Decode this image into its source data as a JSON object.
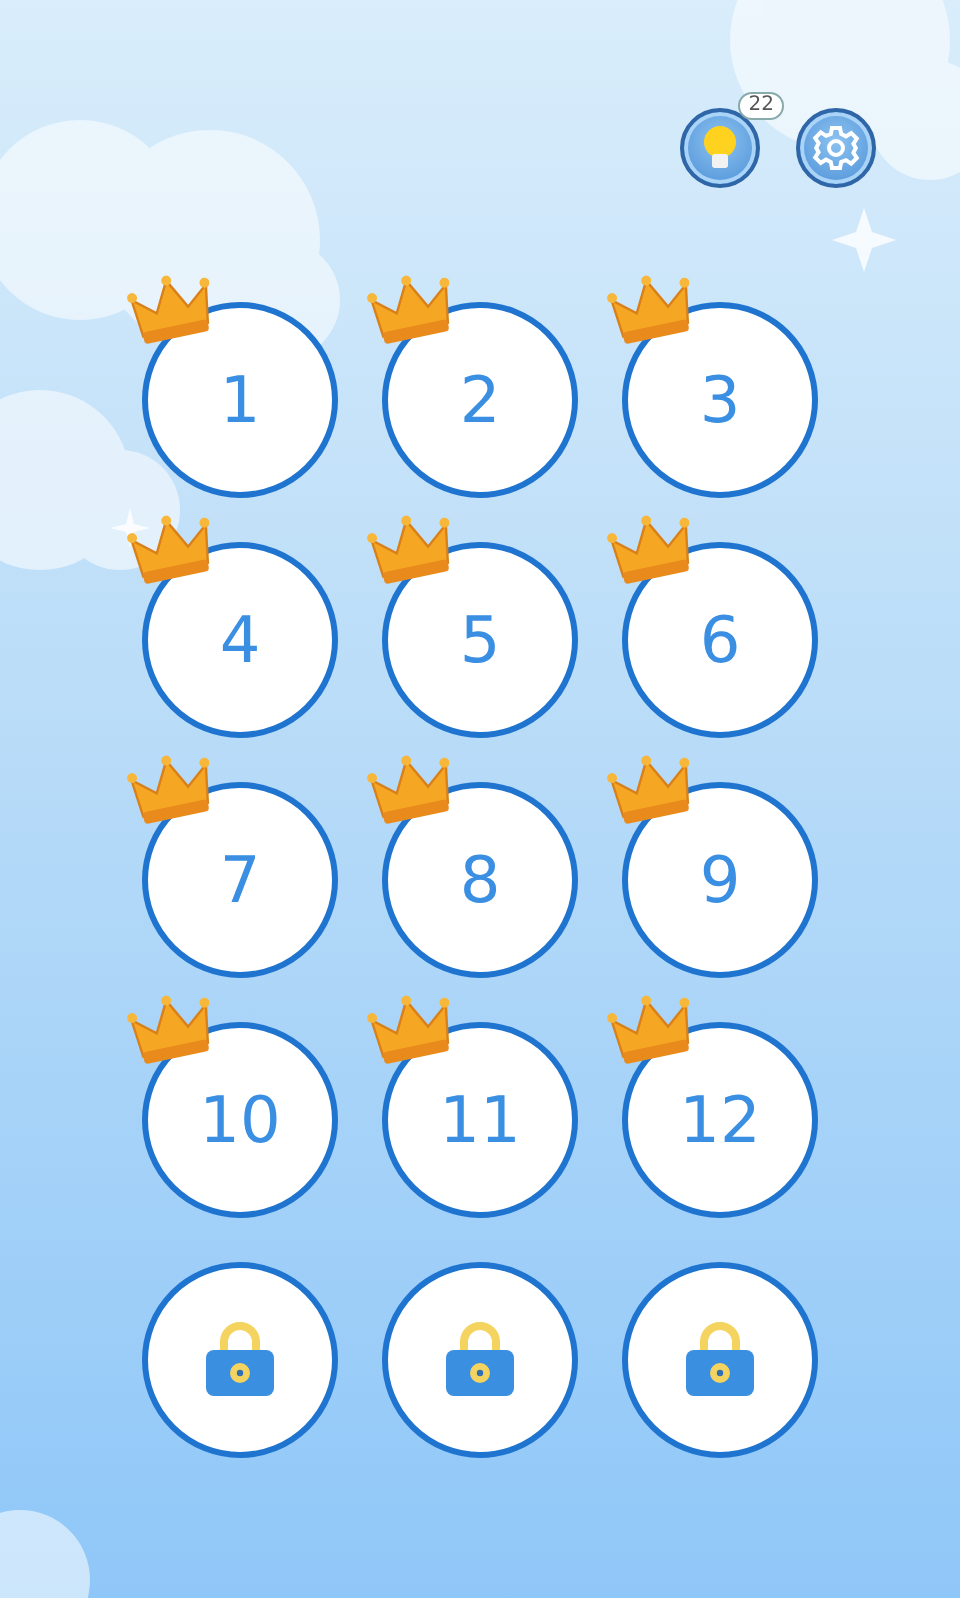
{
  "hint": {
    "count": "22"
  },
  "levels": [
    {
      "kind": "open",
      "label": "1",
      "crowned": true
    },
    {
      "kind": "open",
      "label": "2",
      "crowned": true
    },
    {
      "kind": "open",
      "label": "3",
      "crowned": true
    },
    {
      "kind": "open",
      "label": "4",
      "crowned": true
    },
    {
      "kind": "open",
      "label": "5",
      "crowned": true
    },
    {
      "kind": "open",
      "label": "6",
      "crowned": true
    },
    {
      "kind": "open",
      "label": "7",
      "crowned": true
    },
    {
      "kind": "open",
      "label": "8",
      "crowned": true
    },
    {
      "kind": "open",
      "label": "9",
      "crowned": true
    },
    {
      "kind": "open",
      "label": "10",
      "crowned": true
    },
    {
      "kind": "open",
      "label": "11",
      "crowned": true
    },
    {
      "kind": "open",
      "label": "12",
      "crowned": true
    },
    {
      "kind": "locked",
      "crowned": false
    },
    {
      "kind": "locked",
      "crowned": false
    },
    {
      "kind": "locked",
      "crowned": false
    }
  ]
}
